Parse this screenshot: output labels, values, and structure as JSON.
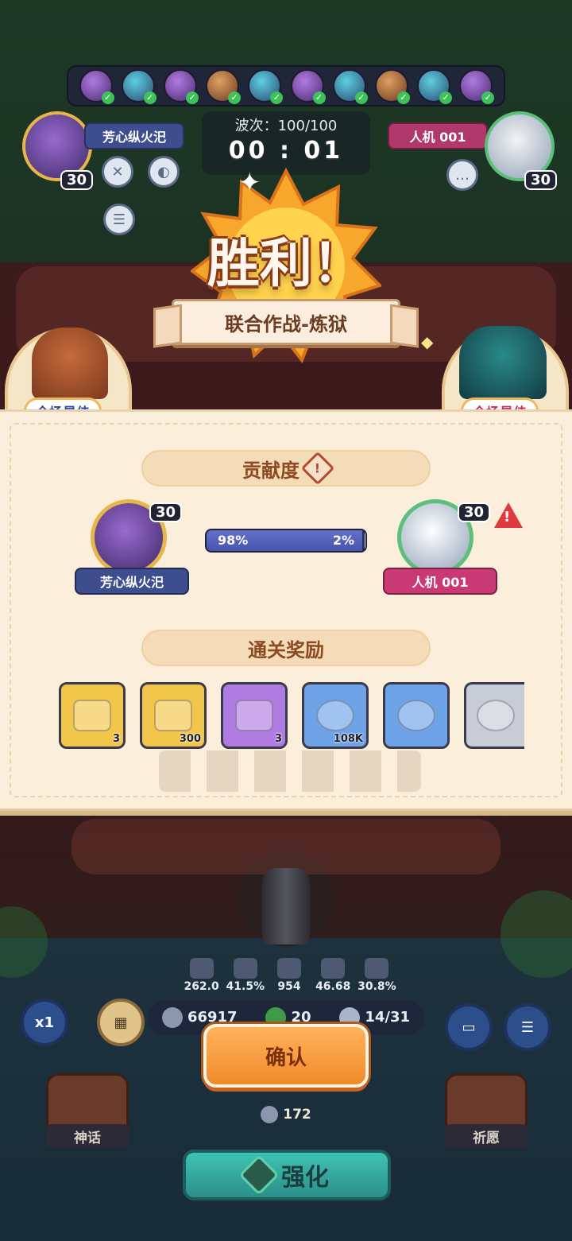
{
  "top": {
    "player_name": "芳心纵火汜",
    "player_level": "30",
    "opponent_name": "人机 001",
    "opponent_level": "30",
    "wave_text": "波次：100/100",
    "timer": "00 : 01",
    "hero_slots": 10
  },
  "victory": {
    "title": "胜利！",
    "mode": "联合作战-炼狱",
    "mvp_left": "全场最佳",
    "mvp_right": "全场最佳"
  },
  "contribution": {
    "title": "贡献度",
    "info_icon": "info-diamond-icon",
    "player_name": "芳心纵火汜",
    "player_level": "30",
    "opponent_name": "人机 001",
    "opponent_level": "30",
    "player_pct_label": "98%",
    "opponent_pct_label": "2%",
    "player_fraction": 0.98,
    "warning_icon": "warning-triangle-icon"
  },
  "rewards": {
    "title": "通关奖励",
    "items": [
      {
        "name": "gold-chest",
        "qty": "3",
        "color": "#f2c64a"
      },
      {
        "name": "key",
        "qty": "300",
        "color": "#f2c64a"
      },
      {
        "name": "purple-chest",
        "qty": "3",
        "color": "#b07be0"
      },
      {
        "name": "gold-coin",
        "qty": "108K",
        "color": "#6fa3e8"
      },
      {
        "name": "blue-orb",
        "qty": "",
        "color": "#6fa3e8"
      },
      {
        "name": "silver-emblem",
        "qty": "",
        "color": "#c7ccd6"
      }
    ]
  },
  "hud": {
    "stats": [
      "262.0",
      "41.5%",
      "954",
      "46.68",
      "30.8%"
    ],
    "resources": [
      "66917",
      "20",
      "14/31"
    ],
    "speed_label": "x1",
    "confirm_label": "确认",
    "upgrade_label": "强化",
    "cost": "172",
    "left_card_label": "神话",
    "right_card_label": "祈愿"
  }
}
